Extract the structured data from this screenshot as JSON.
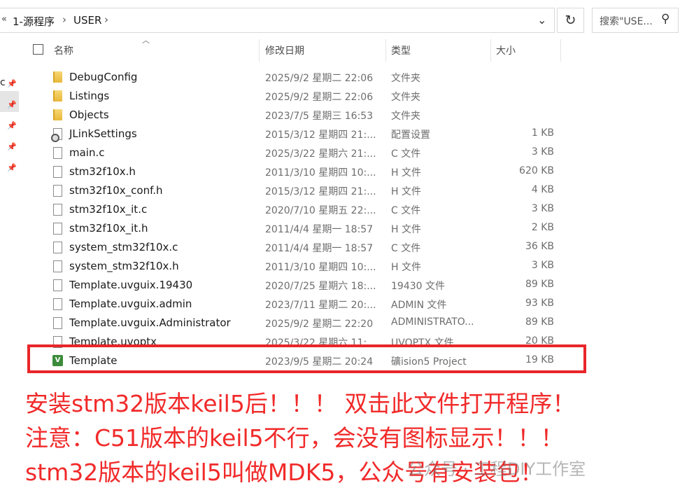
{
  "address_bar": {
    "back_chevron": "«",
    "crumbs": [
      "1-源程序",
      "USER"
    ],
    "separator": "›",
    "dropdown_icon": "chevron-down-icon",
    "refresh_icon": "refresh-icon",
    "search_placeholder": "搜索\"USE...",
    "search_icon": "search-icon"
  },
  "nav_pane": {
    "visible_text": "c"
  },
  "columns": {
    "name": "名称",
    "date": "修改日期",
    "type": "类型",
    "size": "大小"
  },
  "files": [
    {
      "name": "DebugConfig",
      "date": "2025/9/2 星期二 22:06",
      "type": "文件夹",
      "size": "",
      "icon": "folder-icon"
    },
    {
      "name": "Listings",
      "date": "2025/9/2 星期二 22:06",
      "type": "文件夹",
      "size": "",
      "icon": "folder-icon"
    },
    {
      "name": "Objects",
      "date": "2023/7/5 星期三 16:53",
      "type": "文件夹",
      "size": "",
      "icon": "folder-icon"
    },
    {
      "name": "JLinkSettings",
      "date": "2015/3/12 星期四 21:...",
      "type": "配置设置",
      "size": "1 KB",
      "icon": "settings-file-icon"
    },
    {
      "name": "main.c",
      "date": "2025/3/22 星期六 21:...",
      "type": "C 文件",
      "size": "3 KB",
      "icon": "file-icon"
    },
    {
      "name": "stm32f10x.h",
      "date": "2011/3/10 星期四 10:...",
      "type": "H 文件",
      "size": "620 KB",
      "icon": "file-icon"
    },
    {
      "name": "stm32f10x_conf.h",
      "date": "2015/3/12 星期四 21:...",
      "type": "H 文件",
      "size": "4 KB",
      "icon": "file-icon"
    },
    {
      "name": "stm32f10x_it.c",
      "date": "2020/7/10 星期五 22:...",
      "type": "C 文件",
      "size": "3 KB",
      "icon": "file-icon"
    },
    {
      "name": "stm32f10x_it.h",
      "date": "2011/4/4 星期一 18:57",
      "type": "H 文件",
      "size": "2 KB",
      "icon": "file-icon"
    },
    {
      "name": "system_stm32f10x.c",
      "date": "2011/4/4 星期一 18:57",
      "type": "C 文件",
      "size": "36 KB",
      "icon": "file-icon"
    },
    {
      "name": "system_stm32f10x.h",
      "date": "2011/3/10 星期四 10:...",
      "type": "H 文件",
      "size": "3 KB",
      "icon": "file-icon"
    },
    {
      "name": "Template.uvguix.19430",
      "date": "2020/7/25 星期六 18:...",
      "type": "19430 文件",
      "size": "89 KB",
      "icon": "file-icon"
    },
    {
      "name": "Template.uvguix.admin",
      "date": "2023/7/11 星期二 20:...",
      "type": "ADMIN 文件",
      "size": "93 KB",
      "icon": "file-icon"
    },
    {
      "name": "Template.uvguix.Administrator",
      "date": "2025/9/2 星期二 22:20",
      "type": "ADMINISTRATO...",
      "size": "89 KB",
      "icon": "file-icon"
    },
    {
      "name": "Template.uvoptx",
      "date": "2025/3/22 星期六 11:...",
      "type": "UVOPTX 文件",
      "size": "20 KB",
      "icon": "file-icon"
    },
    {
      "name": "Template",
      "date": "2023/9/5 星期二 20:24",
      "type": "礦ision5 Project",
      "size": "19 KB",
      "icon": "keil-project-icon"
    }
  ],
  "annotation": {
    "line1": "安装stm32版本keil5后！！！ 双击此文件打开程序！",
    "line2": "注意：C51版本的keil5不行，会没有图标显示！！！",
    "line3": "stm32版本的keil5叫做MDK5，公众号有安装包！",
    "color": "#f12a2a"
  },
  "watermark": "公众号 · 工程DIY工作室"
}
